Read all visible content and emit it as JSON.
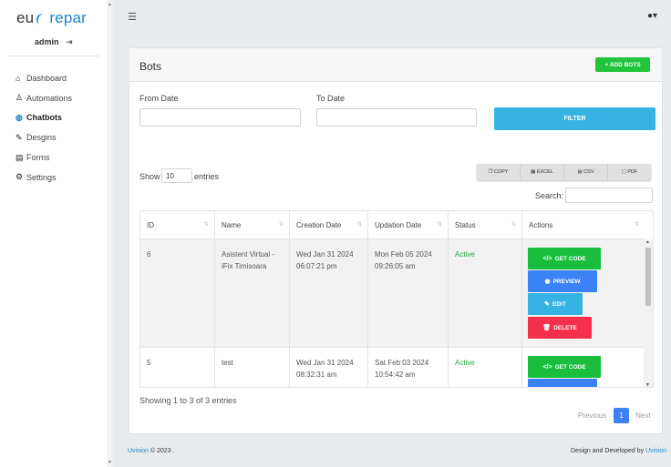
{
  "sidebar": {
    "logo_left": "eu",
    "logo_right": "repar",
    "user": "admin",
    "logout_icon": "sign-out-icon",
    "items": [
      {
        "label": "Dashboard",
        "icon": "home-icon"
      },
      {
        "label": "Automations",
        "icon": "users-cog-icon"
      },
      {
        "label": "Chatbots",
        "icon": "globe-icon",
        "active": true
      },
      {
        "label": "Desgins",
        "icon": "paint-brush-icon"
      },
      {
        "label": "Forms",
        "icon": "file-icon"
      },
      {
        "label": "Settings",
        "icon": "cogs-icon"
      }
    ]
  },
  "topbar": {
    "menu_icon": "hamburger-icon",
    "user_icon": "user-icon"
  },
  "card": {
    "title": "Bots",
    "add_button": "+ ADD BOTS",
    "from_label": "From Date",
    "to_label": "To Date",
    "filter_button": "FILTER"
  },
  "table_controls": {
    "show_label": "Show",
    "length_value": "10",
    "entries_label": "entries",
    "export": [
      "COPY",
      "EXCEL",
      "CSV",
      "PDF"
    ],
    "search_label": "Search:"
  },
  "table": {
    "headers": [
      "ID",
      "Name",
      "Creation Date",
      "Updation Date",
      "Status",
      "Actions"
    ],
    "rows": [
      {
        "id": "6",
        "name_1": "Asistent Virtual -",
        "name_2": "iFix Timisoara",
        "created_1": "Wed Jan 31 2024",
        "created_2": "06:07:21 pm",
        "updated_1": "Mon Feb 05 2024",
        "updated_2": "09:26:05 am",
        "status": "Active"
      },
      {
        "id": "5",
        "name_1": "test",
        "name_2": "",
        "created_1": "Wed Jan 31 2024",
        "created_2": "08:32:31 am",
        "updated_1": "Sat Feb 03 2024",
        "updated_2": "10:54:42 am",
        "status": "Active"
      }
    ],
    "actions": {
      "get_code": "GET CODE",
      "preview": "PREVIEW",
      "edit": "EDIT",
      "delete": "DELETE"
    }
  },
  "pagination": {
    "info": "Showing 1 to 3 of 3 entries",
    "previous": "Previous",
    "current": "1",
    "next": "Next"
  },
  "footer": {
    "brand": "Uvision",
    "copyright": "© 2023 .",
    "credit": "Design and Developed by",
    "credit_link": "Uvision"
  },
  "colors": {
    "accent": "#1f86c9",
    "green": "#19bf3c",
    "blue": "#3a82f6",
    "cyan": "#36b3e3",
    "red": "#f4304d"
  }
}
